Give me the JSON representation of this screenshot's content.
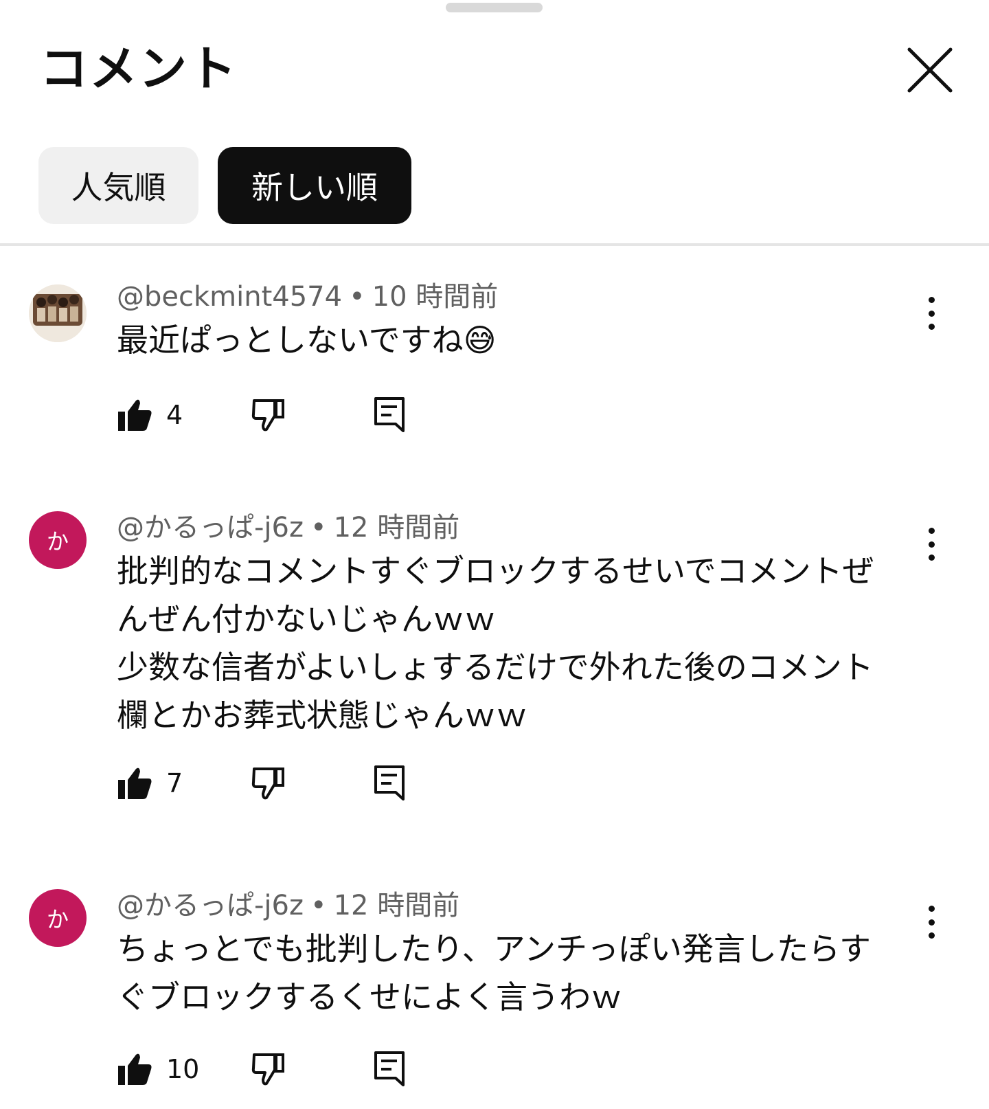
{
  "panel": {
    "title": "コメント"
  },
  "sort": {
    "popular_label": "人気順",
    "newest_label": "新しい順",
    "selected": "newest"
  },
  "icons": {
    "close": "close-icon",
    "like": "thumbs-up-icon",
    "dislike": "thumbs-down-icon",
    "reply": "reply-icon",
    "more": "more-vert-icon"
  },
  "colors": {
    "avatar_letter_bg": "#c2185b",
    "chip_selected_bg": "#0f0f0f",
    "chip_unselected_bg": "#f0f0f0",
    "meta_text": "#606060"
  },
  "comments": [
    {
      "author": "@beckmint4574",
      "separator": "•",
      "time": "10 時間前",
      "text": "最近ぱっとしないですね😅",
      "likes": "4",
      "avatar": "photo"
    },
    {
      "author": "@かるっぱ-j6z",
      "separator": "•",
      "time": "12 時間前",
      "text": "批判的なコメントすぐブロックするせいでコメントぜんぜん付かないじゃんｗｗ\n少数な信者がよいしょするだけで外れた後のコメント欄とかお葬式状態じゃんｗｗ",
      "likes": "7",
      "avatar": "letter",
      "avatar_letter": "か"
    },
    {
      "author": "@かるっぱ-j6z",
      "separator": "•",
      "time": "12 時間前",
      "text": "ちょっとでも批判したり、アンチっぽい発言したらすぐブロックするくせによく言うわｗ",
      "likes": "10",
      "avatar": "letter",
      "avatar_letter": "か"
    }
  ]
}
